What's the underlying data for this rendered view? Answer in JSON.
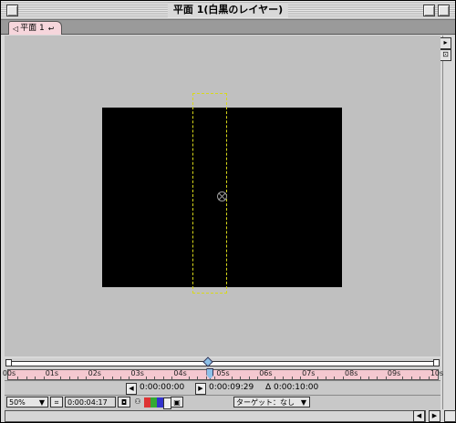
{
  "window": {
    "title": "平面 1(白黒のレイヤー)"
  },
  "tab": {
    "label": "平面 1"
  },
  "timeline": {
    "ticks": [
      "00s",
      "01s",
      "02s",
      "03s",
      "04s",
      "05s",
      "06s",
      "07s",
      "08s",
      "09s",
      "10s"
    ],
    "playhead_position_fraction": 0.47
  },
  "time": {
    "in_point": "0:00:00:00",
    "out_point": "0:00:09:29",
    "duration": "Δ 0:00:10:00"
  },
  "bottom": {
    "zoom": "50%",
    "current_time": "0:00:04:17",
    "target_dropdown": "ターゲット：なし"
  },
  "colors": {
    "tab_bg": "#f6d6dc",
    "ruler_bg": "#f4c8d0",
    "comp_bg": "#c0c0c0",
    "solid": "#000000",
    "selection_outline": "#d8d81a",
    "playhead": "#8cc0e8"
  },
  "icons": [
    "close-box",
    "zoom-box",
    "collapse-box",
    "comp-menu-icon",
    "snapshot-icon",
    "show-snapshot-icon",
    "channel-icons",
    "region-of-interest-icon",
    "grid-icon"
  ]
}
